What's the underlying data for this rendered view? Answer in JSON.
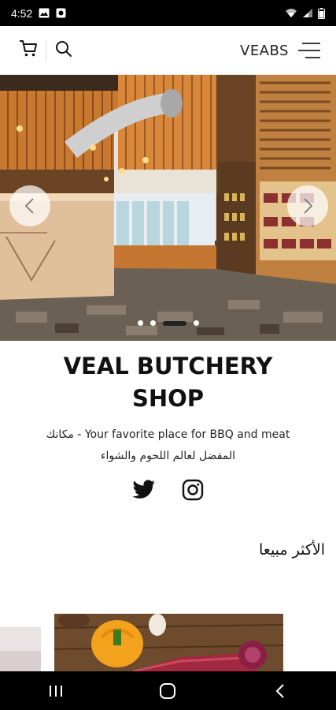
{
  "status_bar": {
    "time": "4:52",
    "left_icons": [
      "image-icon",
      "notification-app-icon"
    ],
    "right_icons": [
      "wifi-icon",
      "signal-icon",
      "battery-icon"
    ]
  },
  "header": {
    "brand": "VEABS",
    "icons": [
      "cart-icon",
      "search-icon",
      "menu-icon"
    ]
  },
  "hero": {
    "slide_count": 4,
    "active_slide_index": 2,
    "prev_icon": "chevron-left-icon",
    "next_icon": "chevron-right-icon"
  },
  "content": {
    "title_line1": "VEAL BUTCHERY",
    "title_line2": "SHOP",
    "subtitle_line1": "مكانك - Your favorite place for BBQ and meat",
    "subtitle_line2": "المفضل لعالم اللحوم والشواء",
    "social": [
      "twitter-icon",
      "instagram-icon"
    ],
    "section_title": "الأكثر مبيعا"
  },
  "nav_bar": {
    "icons": [
      "recent-apps-icon",
      "home-icon",
      "back-icon"
    ]
  },
  "colors": {
    "status_bar": "#000000",
    "nav_bar": "#000000",
    "text": "#111111",
    "accent_wood": "#c9782f"
  }
}
